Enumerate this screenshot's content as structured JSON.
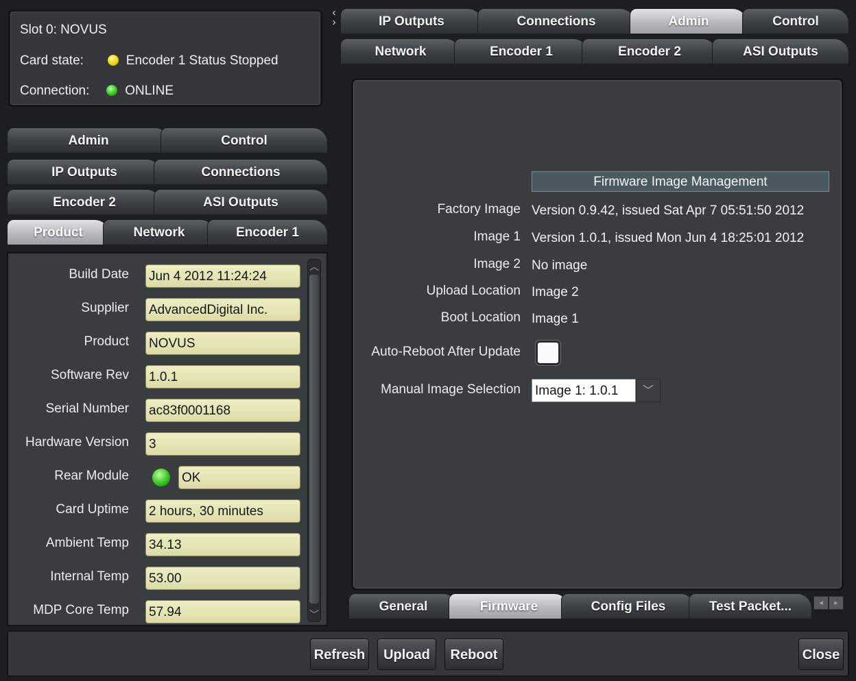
{
  "status": {
    "slot": "Slot 0: NOVUS",
    "card_state_label": "Card state:",
    "card_state_value": "Encoder 1 Status Stopped",
    "connection_label": "Connection:",
    "connection_value": "ONLINE"
  },
  "left_tabs": {
    "row1": [
      "Admin",
      "Control"
    ],
    "row2": [
      "IP Outputs",
      "Connections"
    ],
    "row3": [
      "Encoder 2",
      "ASI Outputs"
    ],
    "row4": [
      "Product",
      "Network",
      "Encoder 1"
    ],
    "active": "Product"
  },
  "product": {
    "fields": [
      {
        "label": "Build Date",
        "value": "Jun  4 2012 11:24:24"
      },
      {
        "label": "Supplier",
        "value": "AdvancedDigital Inc."
      },
      {
        "label": "Product",
        "value": "NOVUS"
      },
      {
        "label": "Software Rev",
        "value": "1.0.1"
      },
      {
        "label": "Serial Number",
        "value": "ac83f0001168"
      },
      {
        "label": "Hardware Version",
        "value": "3"
      },
      {
        "label": "Rear Module",
        "value": "OK"
      },
      {
        "label": "Card Uptime",
        "value": "2 hours, 30 minutes"
      },
      {
        "label": "Ambient Temp",
        "value": "34.13"
      },
      {
        "label": "Internal Temp",
        "value": "53.00"
      },
      {
        "label": "MDP Core Temp",
        "value": "57.94"
      }
    ]
  },
  "right_tabs": {
    "row1": [
      "IP Outputs",
      "Connections",
      "Admin",
      "Control"
    ],
    "row2": [
      "Network",
      "Encoder 1",
      "Encoder 2",
      "ASI Outputs"
    ],
    "active": "Admin"
  },
  "firmware": {
    "header": "Firmware Image Management",
    "rows": [
      {
        "label": "Factory Image",
        "value": "Version 0.9.42, issued Sat Apr 7 05:51:50 2012"
      },
      {
        "label": "Image 1",
        "value": "Version 1.0.1, issued Mon Jun 4 18:25:01 2012"
      },
      {
        "label": "Image 2",
        "value": "No image"
      },
      {
        "label": "Upload Location",
        "value": "Image 2"
      },
      {
        "label": "Boot Location",
        "value": "Image 1"
      }
    ],
    "auto_reboot_label": "Auto-Reboot After Update",
    "auto_reboot_checked": false,
    "manual_select_label": "Manual Image Selection",
    "manual_select_value": "Image 1: 1.0.1"
  },
  "bottom_tabs": {
    "items": [
      "General",
      "Firmware",
      "Config Files",
      "Test Packet..."
    ],
    "active": "Firmware"
  },
  "buttons": {
    "refresh": "Refresh",
    "upload": "Upload",
    "reboot": "Reboot",
    "close": "Close"
  }
}
